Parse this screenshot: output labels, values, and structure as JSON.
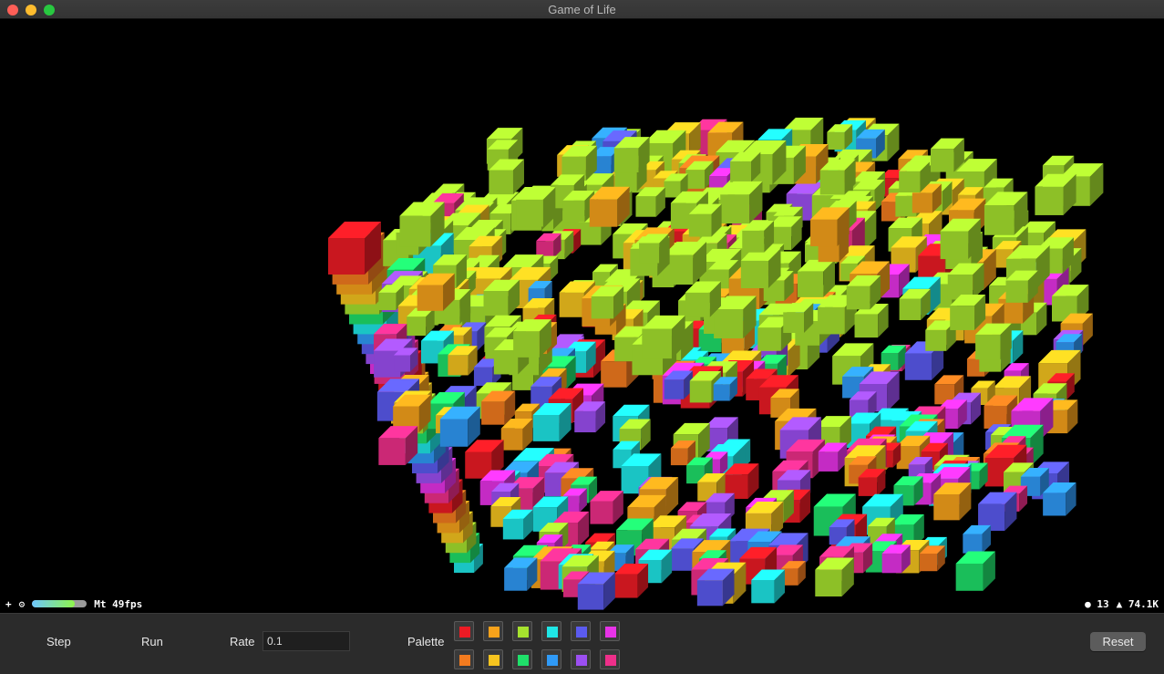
{
  "window": {
    "title": "Game of Life"
  },
  "hud": {
    "add_symbol": "+",
    "settings_symbol": "⚙",
    "load_level": 0.78,
    "fps_text": "Mt 49fps",
    "nodes_text": "● 13",
    "triangles_text": "▲ 74.1K"
  },
  "toolbar": {
    "step_label": "Step",
    "run_label": "Run",
    "rate_label": "Rate",
    "rate_value": "0.1",
    "palette_label": "Palette",
    "palette_colors": [
      "#ed1b24",
      "#f7a21b",
      "#a6e22e",
      "#1fe6e6",
      "#5b5bf0",
      "#e733e7",
      "#f37b1f",
      "#f6c41f",
      "#1fe06a",
      "#2f9af7",
      "#9c4ff2",
      "#ef2f8a"
    ],
    "reset_label": "Reset"
  },
  "scene": {
    "description_icon": "voxel-cubes-icon",
    "colors": [
      "#ed1b24",
      "#f37b1f",
      "#f7a21b",
      "#f6c41f",
      "#a6e22e",
      "#1fe06a",
      "#1fe6e6",
      "#2f9af7",
      "#5b5bf0",
      "#9c4ff2",
      "#e733e7",
      "#ef2f8a"
    ]
  }
}
